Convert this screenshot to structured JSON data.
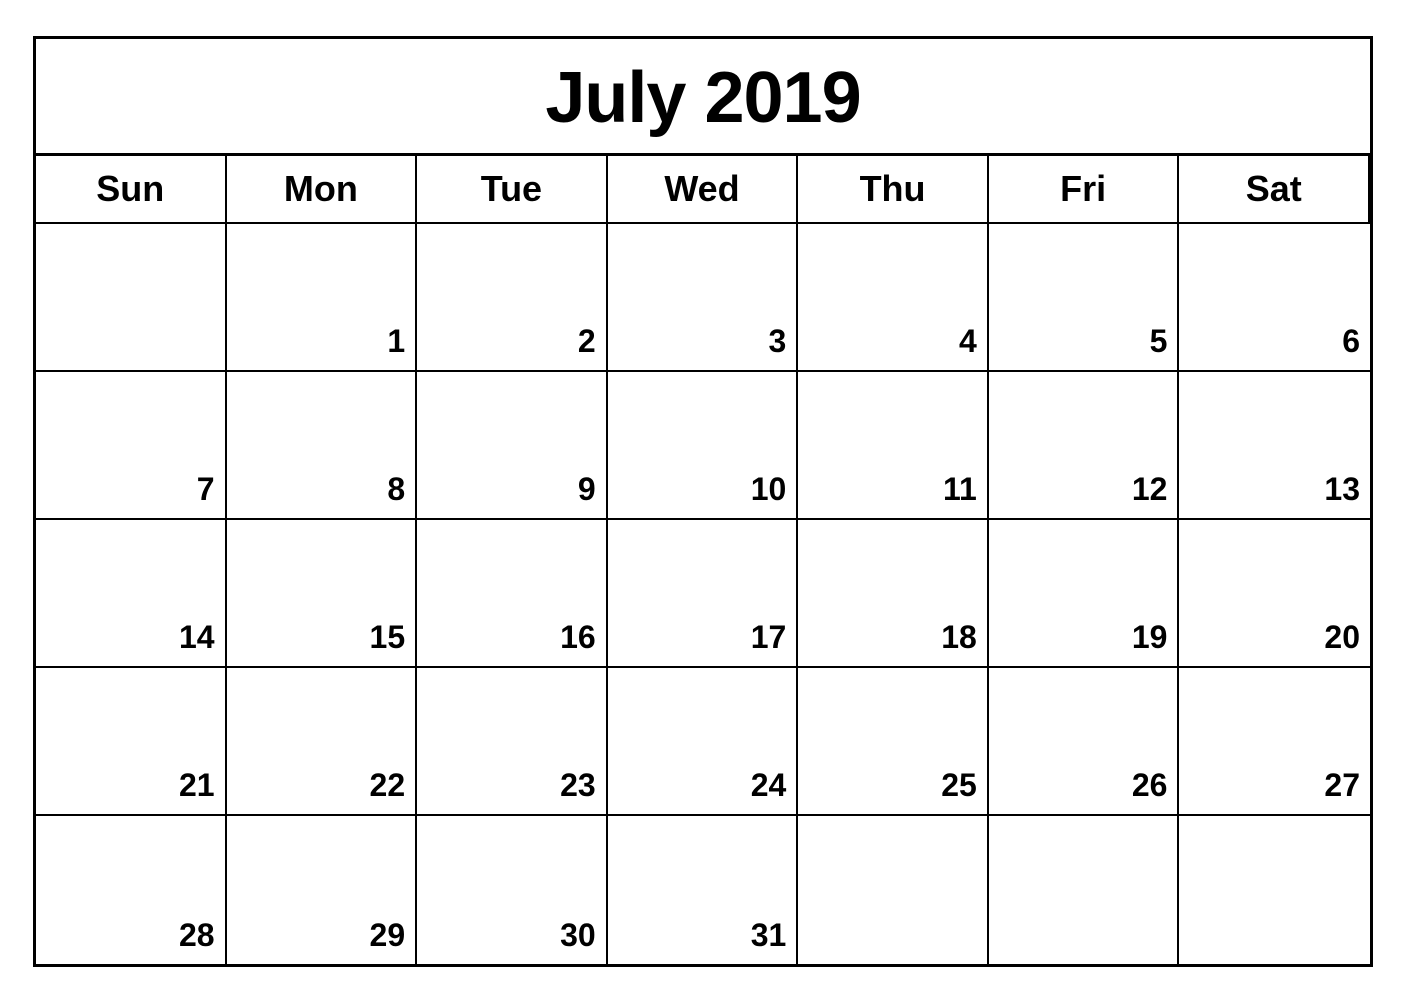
{
  "calendar": {
    "title": "July 2019",
    "headers": [
      "Sun",
      "Mon",
      "Tue",
      "Wed",
      "Thu",
      "Fri",
      "Sat"
    ],
    "weeks": [
      [
        {
          "day": null
        },
        {
          "day": 1
        },
        {
          "day": 2
        },
        {
          "day": 3
        },
        {
          "day": 4
        },
        {
          "day": 5
        },
        {
          "day": 6
        }
      ],
      [
        {
          "day": 7
        },
        {
          "day": 8
        },
        {
          "day": 9
        },
        {
          "day": 10
        },
        {
          "day": 11
        },
        {
          "day": 12
        },
        {
          "day": 13
        }
      ],
      [
        {
          "day": 14
        },
        {
          "day": 15
        },
        {
          "day": 16
        },
        {
          "day": 17
        },
        {
          "day": 18
        },
        {
          "day": 19
        },
        {
          "day": 20
        }
      ],
      [
        {
          "day": 21
        },
        {
          "day": 22
        },
        {
          "day": 23
        },
        {
          "day": 24
        },
        {
          "day": 25
        },
        {
          "day": 26
        },
        {
          "day": 27
        }
      ],
      [
        {
          "day": 28
        },
        {
          "day": 29
        },
        {
          "day": 30
        },
        {
          "day": 31
        },
        {
          "day": null
        },
        {
          "day": null
        },
        {
          "day": null
        }
      ]
    ]
  }
}
